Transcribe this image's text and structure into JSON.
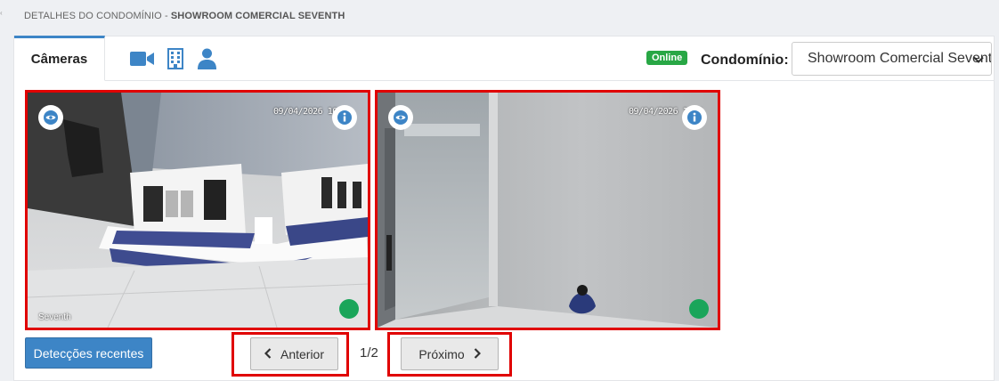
{
  "breadcrumb": {
    "prefix": "DETALHES DO CONDOMÍNIO - ",
    "name": "SHOWROOM COMERCIAL SEVENTH"
  },
  "tabs": {
    "active_label": "Câmeras",
    "icons": [
      "video-camera-icon",
      "building-icon",
      "user-icon"
    ]
  },
  "status": {
    "online_label": "Online",
    "online_color": "#28a745"
  },
  "condominio": {
    "label": "Condomínio:",
    "selected": "Showroom Comercial Seventh"
  },
  "cameras": [
    {
      "timestamp": "09/04/2026 10:3",
      "overlay_label": "Seventh",
      "status_color": "#1aa55a"
    },
    {
      "timestamp": "09/04/2026 10:4",
      "overlay_label": "",
      "status_color": "#1aa55a"
    }
  ],
  "actions": {
    "detections_label": "Detecções recentes",
    "prev_label": "Anterior",
    "next_label": "Próximo",
    "page_indicator": "1/2"
  },
  "colors": {
    "accent": "#3d85c6",
    "highlight": "#e00000"
  }
}
